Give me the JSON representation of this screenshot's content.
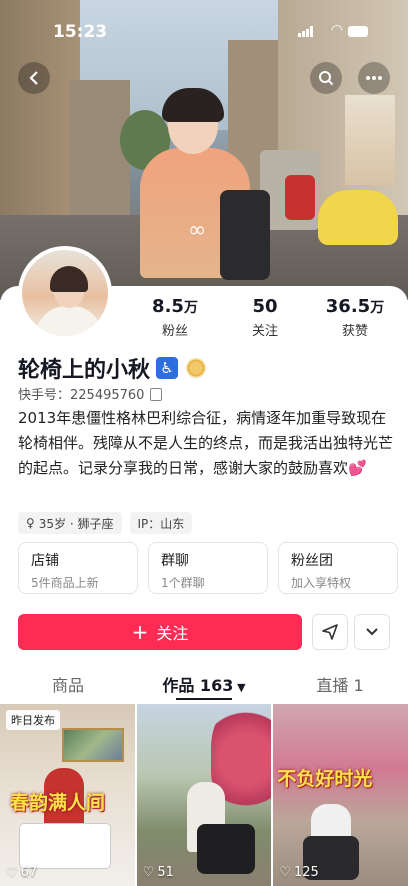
{
  "status": {
    "time": "15:23"
  },
  "profile": {
    "nickname": "轮椅上的小秋",
    "accessibility_icon": "♿",
    "uid_label": "快手号：225495760",
    "bio": "2013年患僵性格林巴利综合征，病情逐年加重导致现在轮椅相伴。残障从不是人生的终点，而是我活出独特光芒的起点。记录分享我的日常，感谢大家的鼓励喜欢",
    "bio_emoji": "💕",
    "stats": [
      {
        "num": "8.5",
        "unit": "万",
        "label": "粉丝"
      },
      {
        "num": "50",
        "unit": "",
        "label": "关注"
      },
      {
        "num": "36.5",
        "unit": "万",
        "label": "获赞"
      }
    ],
    "tags": [
      {
        "text": "35岁 · 狮子座",
        "icon": "female-icon"
      },
      {
        "text": "IP：山东"
      }
    ],
    "boxes": [
      {
        "title": "店铺",
        "sub": "5件商品上新"
      },
      {
        "title": "群聊",
        "sub": "1个群聊"
      },
      {
        "title": "粉丝团",
        "sub": "加入享特权"
      }
    ],
    "follow_label": "关注"
  },
  "tabs": [
    {
      "label": "商品"
    },
    {
      "label": "作品 163"
    },
    {
      "label": "直播 1"
    }
  ],
  "grid": [
    {
      "pill": "昨日发布",
      "caption": "春韵满人间",
      "likes": "67"
    },
    {
      "likes": "51"
    },
    {
      "caption": "不负好时光",
      "likes": "125"
    }
  ]
}
